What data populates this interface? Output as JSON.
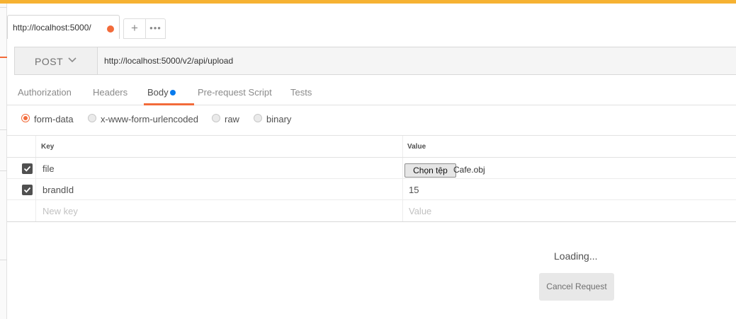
{
  "colors": {
    "accent": "#f26b3a",
    "top_bar": "#f6b232",
    "body_dot": "#097bed"
  },
  "request_tab": {
    "title": "http://localhost:5000/",
    "unsaved_dot_icon": "dot-icon"
  },
  "tab_actions": {
    "add": "+",
    "more": "•••"
  },
  "request": {
    "method": "POST",
    "url": "http://localhost:5000/v2/api/upload"
  },
  "sub_tabs": {
    "authorization": "Authorization",
    "headers": "Headers",
    "body": "Body",
    "pre_request": "Pre-request Script",
    "tests": "Tests",
    "active": "Body"
  },
  "body_modes": {
    "form_data": "form-data",
    "urlencoded": "x-www-form-urlencoded",
    "raw": "raw",
    "binary": "binary",
    "selected": "form-data"
  },
  "table": {
    "key_header": "Key",
    "value_header": "Value",
    "rows": [
      {
        "key": "file",
        "checked": true,
        "file_button": "Chọn tệp",
        "file_name": "Cafe.obj"
      },
      {
        "key": "brandId",
        "checked": true,
        "value": "15"
      }
    ],
    "new_key_placeholder": "New key",
    "new_value_placeholder": "Value"
  },
  "status": {
    "loading": "Loading...",
    "cancel_label": "Cancel Request"
  }
}
